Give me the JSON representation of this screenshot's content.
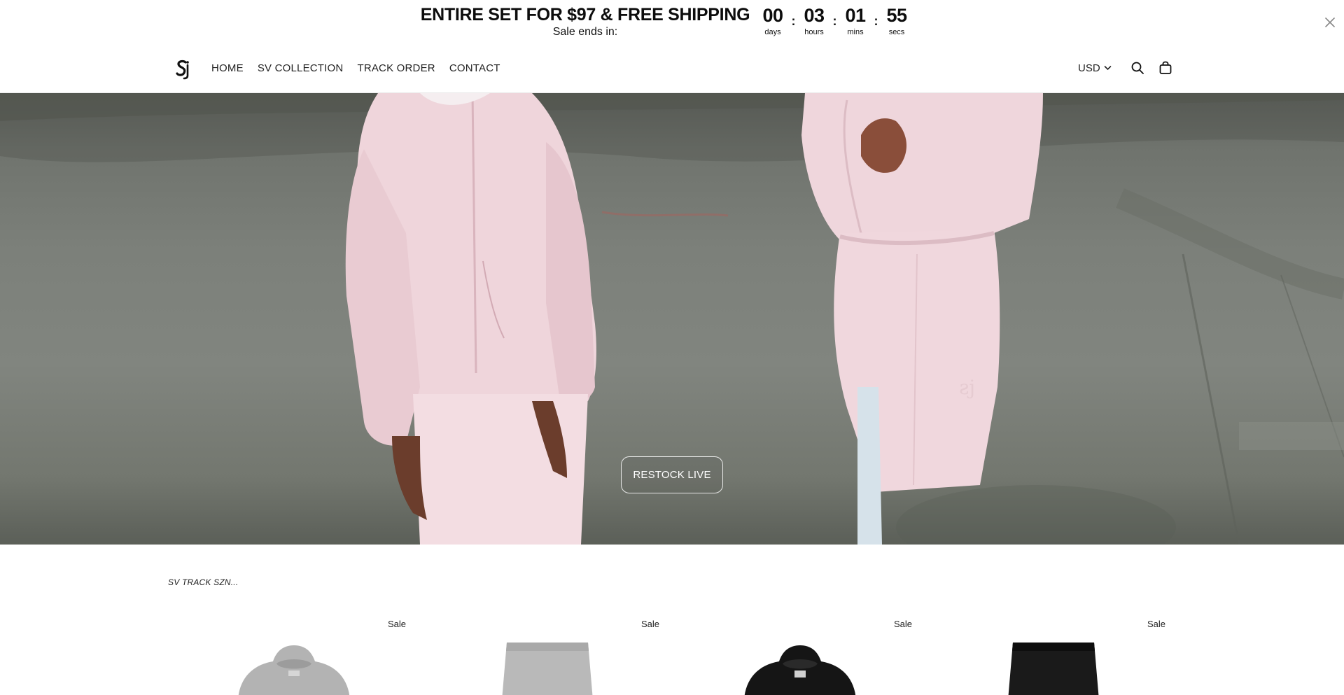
{
  "announcement": {
    "title": "ENTIRE SET FOR $97 & FREE SHIPPING",
    "subtitle": "Sale ends in:",
    "countdown": [
      {
        "value": "00",
        "label": "days"
      },
      {
        "value": "03",
        "label": "hours"
      },
      {
        "value": "01",
        "label": "mins"
      },
      {
        "value": "55",
        "label": "secs"
      }
    ],
    "separator": ":",
    "close_icon": "close-icon"
  },
  "header": {
    "logo_icon": "brand-logo",
    "nav": [
      {
        "label": "HOME"
      },
      {
        "label": "SV COLLECTION"
      },
      {
        "label": "TRACK ORDER"
      },
      {
        "label": "CONTACT"
      }
    ],
    "currency": "USD",
    "currency_icon": "chevron-down-icon",
    "search_icon": "search-icon",
    "cart_icon": "shopping-bag-icon"
  },
  "hero": {
    "cta_label": "RESTOCK LIVE"
  },
  "collection": {
    "title": "SV TRACK SZN...",
    "products": [
      {
        "badge": "Sale",
        "image": "grey-hoodie"
      },
      {
        "badge": "Sale",
        "image": "grey-shorts"
      },
      {
        "badge": "Sale",
        "image": "black-hoodie"
      },
      {
        "badge": "Sale",
        "image": "black-shorts"
      }
    ]
  },
  "colors": {
    "text": "#111111",
    "hero_ground": "#7c807a",
    "outfit_pink": "#f1d9df"
  }
}
